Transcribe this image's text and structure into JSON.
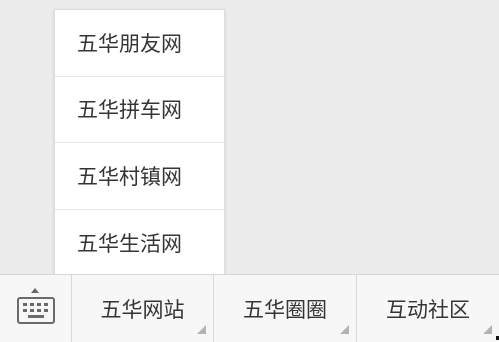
{
  "popup_menu": {
    "items": [
      {
        "label": "五华朋友网"
      },
      {
        "label": "五华拼车网"
      },
      {
        "label": "五华村镇网"
      },
      {
        "label": "五华生活网"
      }
    ]
  },
  "menu_bar": {
    "keyboard_toggle_icon": "keyboard-icon",
    "buttons": [
      {
        "label": "五华网站",
        "has_submenu": true
      },
      {
        "label": "五华圈圈",
        "has_submenu": true
      },
      {
        "label": "互动社区",
        "has_submenu": true
      }
    ]
  },
  "colors": {
    "background": "#ececec",
    "menu_bar": "#f7f7f7",
    "popup": "#ffffff",
    "text": "#353535"
  }
}
